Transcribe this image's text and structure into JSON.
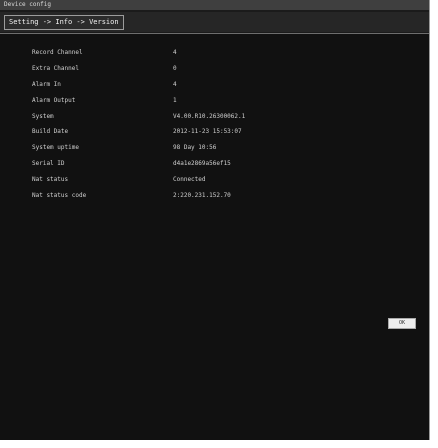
{
  "window": {
    "title": "Device config"
  },
  "breadcrumb": {
    "text": "Setting -> Info -> Version"
  },
  "info": {
    "rows": [
      {
        "label": "Record Channel",
        "value": "4"
      },
      {
        "label": "Extra Channel",
        "value": "0"
      },
      {
        "label": "Alarm In",
        "value": "4"
      },
      {
        "label": "Alarm Output",
        "value": "1"
      },
      {
        "label": "System",
        "value": "V4.00.R10.26300062.1"
      },
      {
        "label": "Build Date",
        "value": "2012-11-23 15:53:07"
      },
      {
        "label": "System uptime",
        "value": "98 Day 10:56"
      },
      {
        "label": "Serial ID",
        "value": "d4a1e2869a56ef15"
      },
      {
        "label": "Nat status",
        "value": "Connected"
      },
      {
        "label": "Nat status code",
        "value": "2:220.231.152.70"
      }
    ]
  },
  "buttons": {
    "ok_label": "OK"
  }
}
